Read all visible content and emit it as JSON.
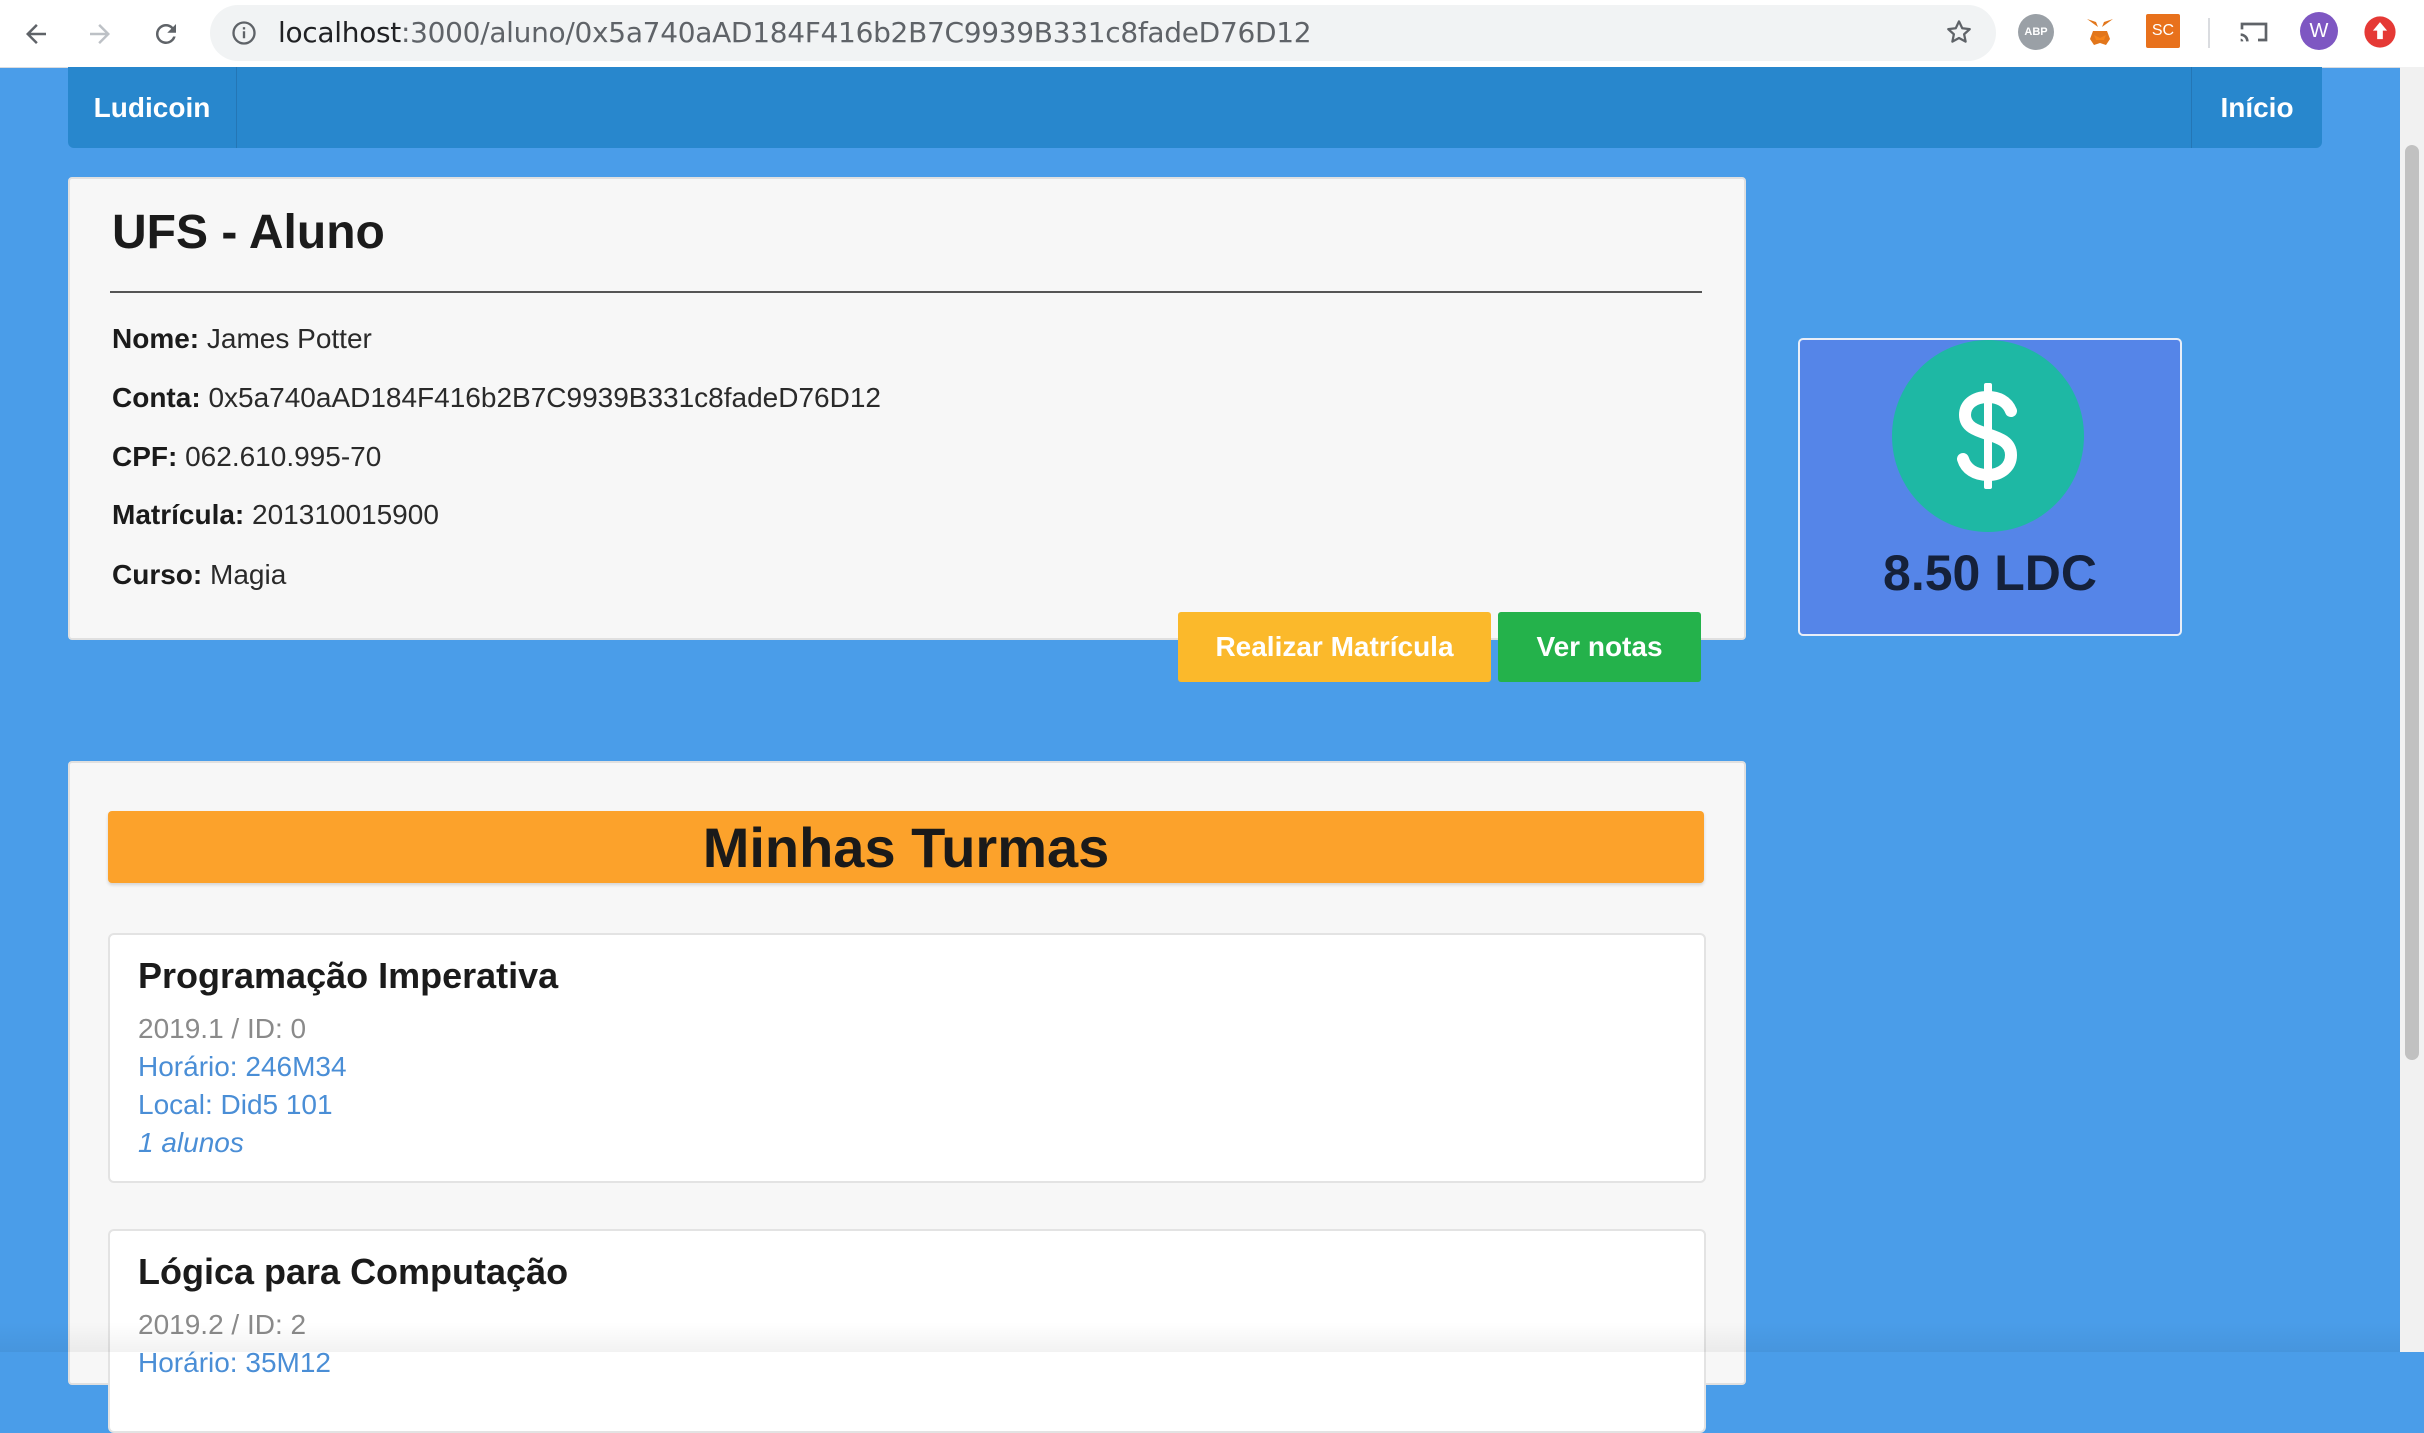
{
  "browser": {
    "url_host": "localhost",
    "url_path": ":3000/aluno/0x5a740aAD184F416b2B7C9939B331c8fadeD76D12",
    "extensions": {
      "abp": "ABP",
      "sc": "SC",
      "avatar": "W"
    }
  },
  "navbar": {
    "brand": "Ludicoin",
    "home": "Início"
  },
  "student": {
    "title": "UFS - Aluno",
    "fields": [
      {
        "label": "Nome:",
        "value": "James Potter"
      },
      {
        "label": "Conta:",
        "value": "0x5a740aAD184F416b2B7C9939B331c8fadeD76D12"
      },
      {
        "label": "CPF:",
        "value": "062.610.995-70"
      },
      {
        "label": "Matrícula:",
        "value": "201310015900"
      },
      {
        "label": "Curso:",
        "value": "Magia"
      }
    ],
    "enroll_button": "Realizar Matrícula",
    "grades_button": "Ver notas"
  },
  "balance": {
    "amount": "8.50 LDC",
    "icon": "dollar-icon"
  },
  "classes": {
    "title": "Minhas Turmas",
    "items": [
      {
        "name": "Programação Imperativa",
        "period": "2019.1 / ID: 0",
        "schedule": "Horário: 246M34",
        "location": "Local: Did5 101",
        "students": "1 alunos"
      },
      {
        "name": "Lógica para Computação",
        "period": "2019.2 / ID: 2",
        "schedule": "Horário: 35M12",
        "location": "",
        "students": ""
      }
    ]
  },
  "colors": {
    "page_bg": "#4a9de9",
    "navbar": "#2887cd",
    "enroll": "#fbb92b",
    "grades": "#24b24b",
    "balance_bg": "#5585e8",
    "coin": "#1eb8a4",
    "classes_header": "#fca22b"
  }
}
